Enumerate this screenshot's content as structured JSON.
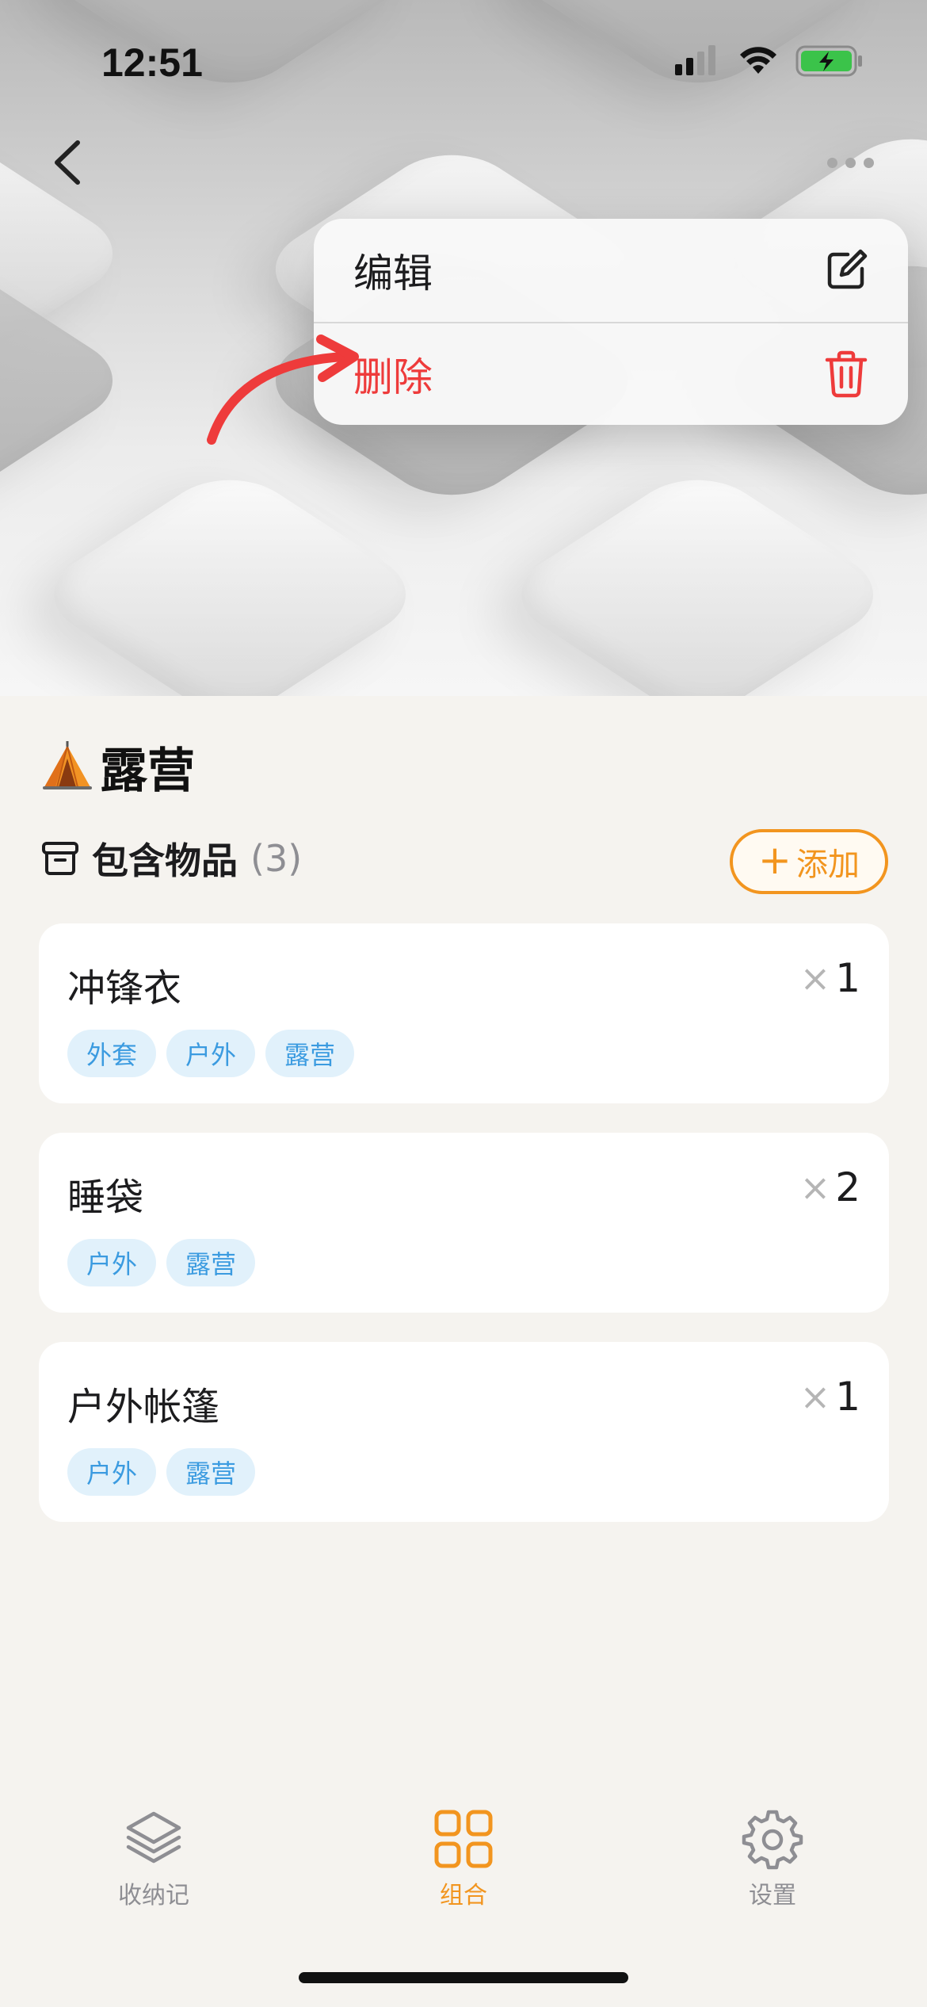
{
  "status_bar": {
    "time": "12:51"
  },
  "menu": {
    "edit_label": "编辑",
    "delete_label": "删除"
  },
  "collection": {
    "emoji": "tent-icon",
    "title": "露营"
  },
  "section": {
    "label": "包含物品",
    "count": "(3)",
    "add_label": "添加"
  },
  "items": [
    {
      "name": "冲锋衣",
      "qty_symbol": "×",
      "qty": "1",
      "tags": [
        "外套",
        "户外",
        "露营"
      ]
    },
    {
      "name": "睡袋",
      "qty_symbol": "×",
      "qty": "2",
      "tags": [
        "户外",
        "露营"
      ]
    },
    {
      "name": "户外帐篷",
      "qty_symbol": "×",
      "qty": "1",
      "tags": [
        "户外",
        "露营"
      ]
    }
  ],
  "tabbar": {
    "tabs": [
      {
        "label": "收纳记",
        "icon": "layers-icon"
      },
      {
        "label": "组合",
        "icon": "grid-icon"
      },
      {
        "label": "设置",
        "icon": "gear-icon"
      }
    ],
    "active_index": 1
  },
  "colors": {
    "accent": "#f2951f",
    "danger": "#ee3b3b",
    "tag_bg": "#e1f1fb",
    "tag_text": "#3b9be0"
  }
}
